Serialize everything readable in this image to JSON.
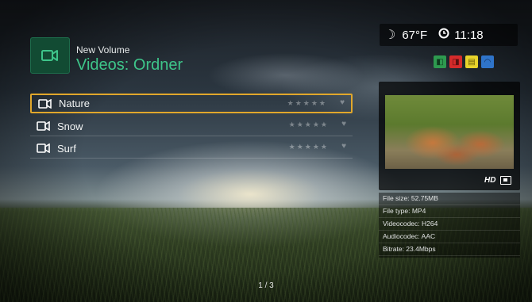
{
  "header": {
    "volume": "New Volume",
    "title": "Videos: Ordner",
    "icon": "video-camera-icon"
  },
  "status": {
    "weather_icon": "moon-weather-icon",
    "temperature": "67°F",
    "time": "11:18"
  },
  "color_keys": [
    {
      "name": "green-key",
      "color": "#2e9a4f",
      "symbol": "◧"
    },
    {
      "name": "red-key",
      "color": "#d52b2b",
      "symbol": "◨"
    },
    {
      "name": "yellow-key",
      "color": "#e7d32b",
      "symbol": "▤"
    },
    {
      "name": "blue-key",
      "color": "#2f74c9",
      "symbol": "◠"
    }
  ],
  "list": {
    "items": [
      {
        "label": "Nature",
        "selected": true
      },
      {
        "label": "Snow",
        "selected": false
      },
      {
        "label": "Surf",
        "selected": false
      }
    ]
  },
  "preview": {
    "hd_label": "HD"
  },
  "info": {
    "file_size": "File size: 52.75MB",
    "file_type": "File type: MP4",
    "videocodec": "Videocodec: H264",
    "audiocodec": "Audiocodec: AAC",
    "bitrate": "Bitrate: 23.4Mbps"
  },
  "pagination": "1 / 3",
  "colors": {
    "accent_green": "#3ec58a",
    "selection_border": "#e1a72b"
  }
}
